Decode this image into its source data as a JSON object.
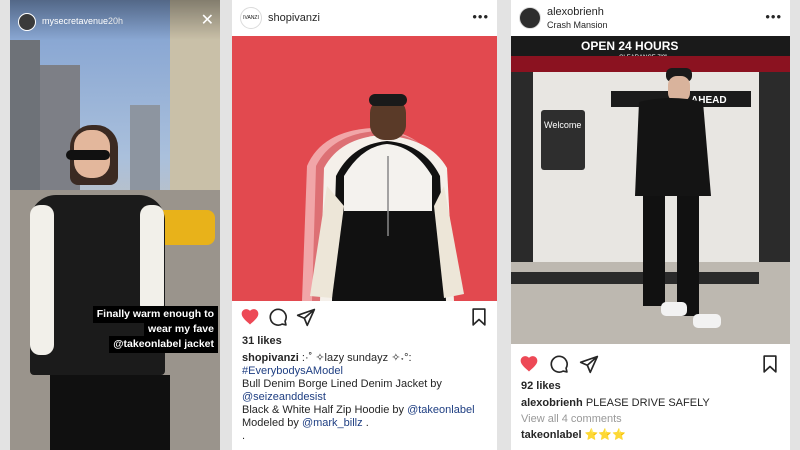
{
  "story": {
    "username": "mysecretavenue",
    "time": "20h",
    "caption_lines": [
      "Finally warm enough to",
      "wear my fave",
      "@takeonlabel jacket"
    ]
  },
  "post1": {
    "username": "shopivanzi",
    "avatar_text": "IVANZI",
    "likes": "31 likes",
    "caption_user": "shopivanzi",
    "caption_text": ":·˚ ✧lazy sundayz ✧˖°:",
    "hashtag": "#EverybodysAModel",
    "line1": "Bull Denim Borge Lined Denim Jacket by",
    "mention1": "@seizeanddesist",
    "line2": "Black & White Half Zip Hoodie by",
    "mention2": "@takeonlabel",
    "line3": "Modeled by",
    "mention3": "@mark_billz",
    "dot": "."
  },
  "post2": {
    "username": "alexobrienh",
    "location": "Crash Mansion",
    "photo_sign": "OPEN 24 HOURS",
    "photo_sign2": "CLEARANCE 7'0\"",
    "photo_sign3": "Welcome",
    "photo_sign4": "AHEAD",
    "likes": "92 likes",
    "caption_user": "alexobrienh",
    "caption_text": "PLEASE DRIVE SAFELY",
    "comments_link": "View all 4 comments",
    "comment_user": "takeonlabel",
    "comment_text": "⭐⭐⭐"
  },
  "colors": {
    "heart": "#ed4956",
    "post1_bg": "#e2494f",
    "link": "#1e3e82"
  }
}
